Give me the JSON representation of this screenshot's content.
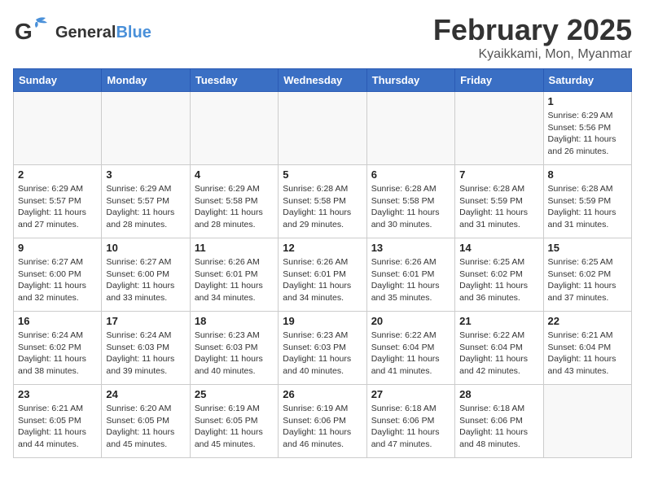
{
  "logo": {
    "text1": "General",
    "text2": "Blue"
  },
  "header": {
    "month": "February 2025",
    "location": "Kyaikkami, Mon, Myanmar"
  },
  "weekdays": [
    "Sunday",
    "Monday",
    "Tuesday",
    "Wednesday",
    "Thursday",
    "Friday",
    "Saturday"
  ],
  "weeks": [
    [
      {
        "day": "",
        "info": ""
      },
      {
        "day": "",
        "info": ""
      },
      {
        "day": "",
        "info": ""
      },
      {
        "day": "",
        "info": ""
      },
      {
        "day": "",
        "info": ""
      },
      {
        "day": "",
        "info": ""
      },
      {
        "day": "1",
        "info": "Sunrise: 6:29 AM\nSunset: 5:56 PM\nDaylight: 11 hours\nand 26 minutes."
      }
    ],
    [
      {
        "day": "2",
        "info": "Sunrise: 6:29 AM\nSunset: 5:57 PM\nDaylight: 11 hours\nand 27 minutes."
      },
      {
        "day": "3",
        "info": "Sunrise: 6:29 AM\nSunset: 5:57 PM\nDaylight: 11 hours\nand 28 minutes."
      },
      {
        "day": "4",
        "info": "Sunrise: 6:29 AM\nSunset: 5:58 PM\nDaylight: 11 hours\nand 28 minutes."
      },
      {
        "day": "5",
        "info": "Sunrise: 6:28 AM\nSunset: 5:58 PM\nDaylight: 11 hours\nand 29 minutes."
      },
      {
        "day": "6",
        "info": "Sunrise: 6:28 AM\nSunset: 5:58 PM\nDaylight: 11 hours\nand 30 minutes."
      },
      {
        "day": "7",
        "info": "Sunrise: 6:28 AM\nSunset: 5:59 PM\nDaylight: 11 hours\nand 31 minutes."
      },
      {
        "day": "8",
        "info": "Sunrise: 6:28 AM\nSunset: 5:59 PM\nDaylight: 11 hours\nand 31 minutes."
      }
    ],
    [
      {
        "day": "9",
        "info": "Sunrise: 6:27 AM\nSunset: 6:00 PM\nDaylight: 11 hours\nand 32 minutes."
      },
      {
        "day": "10",
        "info": "Sunrise: 6:27 AM\nSunset: 6:00 PM\nDaylight: 11 hours\nand 33 minutes."
      },
      {
        "day": "11",
        "info": "Sunrise: 6:26 AM\nSunset: 6:01 PM\nDaylight: 11 hours\nand 34 minutes."
      },
      {
        "day": "12",
        "info": "Sunrise: 6:26 AM\nSunset: 6:01 PM\nDaylight: 11 hours\nand 34 minutes."
      },
      {
        "day": "13",
        "info": "Sunrise: 6:26 AM\nSunset: 6:01 PM\nDaylight: 11 hours\nand 35 minutes."
      },
      {
        "day": "14",
        "info": "Sunrise: 6:25 AM\nSunset: 6:02 PM\nDaylight: 11 hours\nand 36 minutes."
      },
      {
        "day": "15",
        "info": "Sunrise: 6:25 AM\nSunset: 6:02 PM\nDaylight: 11 hours\nand 37 minutes."
      }
    ],
    [
      {
        "day": "16",
        "info": "Sunrise: 6:24 AM\nSunset: 6:02 PM\nDaylight: 11 hours\nand 38 minutes."
      },
      {
        "day": "17",
        "info": "Sunrise: 6:24 AM\nSunset: 6:03 PM\nDaylight: 11 hours\nand 39 minutes."
      },
      {
        "day": "18",
        "info": "Sunrise: 6:23 AM\nSunset: 6:03 PM\nDaylight: 11 hours\nand 40 minutes."
      },
      {
        "day": "19",
        "info": "Sunrise: 6:23 AM\nSunset: 6:03 PM\nDaylight: 11 hours\nand 40 minutes."
      },
      {
        "day": "20",
        "info": "Sunrise: 6:22 AM\nSunset: 6:04 PM\nDaylight: 11 hours\nand 41 minutes."
      },
      {
        "day": "21",
        "info": "Sunrise: 6:22 AM\nSunset: 6:04 PM\nDaylight: 11 hours\nand 42 minutes."
      },
      {
        "day": "22",
        "info": "Sunrise: 6:21 AM\nSunset: 6:04 PM\nDaylight: 11 hours\nand 43 minutes."
      }
    ],
    [
      {
        "day": "23",
        "info": "Sunrise: 6:21 AM\nSunset: 6:05 PM\nDaylight: 11 hours\nand 44 minutes."
      },
      {
        "day": "24",
        "info": "Sunrise: 6:20 AM\nSunset: 6:05 PM\nDaylight: 11 hours\nand 45 minutes."
      },
      {
        "day": "25",
        "info": "Sunrise: 6:19 AM\nSunset: 6:05 PM\nDaylight: 11 hours\nand 45 minutes."
      },
      {
        "day": "26",
        "info": "Sunrise: 6:19 AM\nSunset: 6:06 PM\nDaylight: 11 hours\nand 46 minutes."
      },
      {
        "day": "27",
        "info": "Sunrise: 6:18 AM\nSunset: 6:06 PM\nDaylight: 11 hours\nand 47 minutes."
      },
      {
        "day": "28",
        "info": "Sunrise: 6:18 AM\nSunset: 6:06 PM\nDaylight: 11 hours\nand 48 minutes."
      },
      {
        "day": "",
        "info": ""
      }
    ]
  ]
}
